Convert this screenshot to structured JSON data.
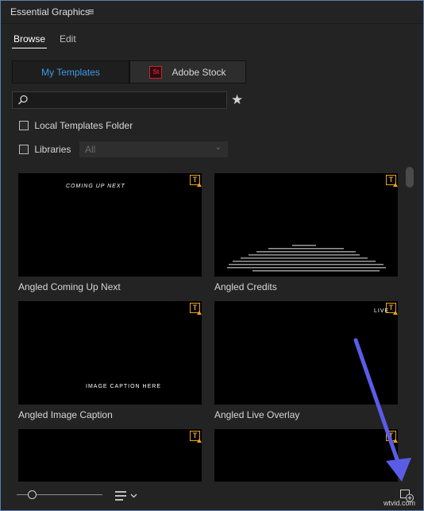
{
  "panel": {
    "title": "Essential Graphics",
    "menu_icon": "hamburger-icon"
  },
  "tabs": [
    {
      "label": "Browse",
      "active": true
    },
    {
      "label": "Edit",
      "active": false
    }
  ],
  "sources": {
    "my_templates": "My Templates",
    "stock_badge": "St",
    "adobe_stock": "Adobe Stock",
    "active": "My Templates",
    "active_color": "#3f9ae8"
  },
  "search": {
    "value": "",
    "icon": "search-icon",
    "favorite_icon": "star-icon"
  },
  "filters": {
    "local_templates_label": "Local Templates Folder",
    "local_templates_checked": false,
    "libraries_label": "Libraries",
    "libraries_checked": false,
    "libraries_select_value": "All"
  },
  "templates": [
    {
      "label": "Angled Coming Up Next",
      "preview_text": "COMING UP NEXT"
    },
    {
      "label": "Angled Credits",
      "preview_text": ""
    },
    {
      "label": "Angled Image Caption",
      "preview_text": "IMAGE CAPTION HERE"
    },
    {
      "label": "Angled Live Overlay",
      "preview_text": "LIVE"
    },
    {
      "label": "",
      "preview_text": ""
    },
    {
      "label": "",
      "preview_text": ""
    }
  ],
  "badge": {
    "text": "T",
    "color": "#e9a31b"
  },
  "footer": {
    "zoom_slider_value": 0.15,
    "list_view_icon": "list-view-icon",
    "new_item_icon": "new-item-icon"
  },
  "watermark": "wtvid.com",
  "annotation_arrow_color": "#5b5ce6"
}
